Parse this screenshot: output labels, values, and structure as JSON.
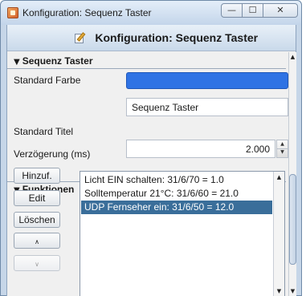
{
  "window": {
    "title": "Konfiguration: Sequenz Taster",
    "minimize_glyph": "—",
    "maximize_glyph": "☐",
    "close_glyph": "✕"
  },
  "header": {
    "title": "Konfiguration: Sequenz Taster",
    "icon": "edit-document-icon"
  },
  "section_main": {
    "title": "Sequenz Taster",
    "fields": {
      "standard_farbe_label": "Standard Farbe",
      "standard_farbe_value": "#2f73e4",
      "standard_titel_label": "Standard Titel",
      "standard_titel_value": "Sequenz Taster",
      "verzoegerung_label": "Verzögerung (ms)",
      "verzoegerung_value": "2.000"
    }
  },
  "section_funktionen": {
    "title": "Funktionen",
    "buttons": {
      "add": "Hinzuf.",
      "edit": "Edit",
      "delete": "Löschen",
      "up": "∧",
      "down": "∨"
    },
    "items": [
      "Licht EIN schalten: 31/6/70 = 1.0",
      "Solltemperatur 21°C: 31/6/60 = 21.0",
      "UDP Fernseher ein: 31/6/50 = 12.0"
    ],
    "selected_index": 2
  },
  "icons": {
    "collapse": "▼",
    "scroll_up": "▲",
    "scroll_down": "▼"
  }
}
